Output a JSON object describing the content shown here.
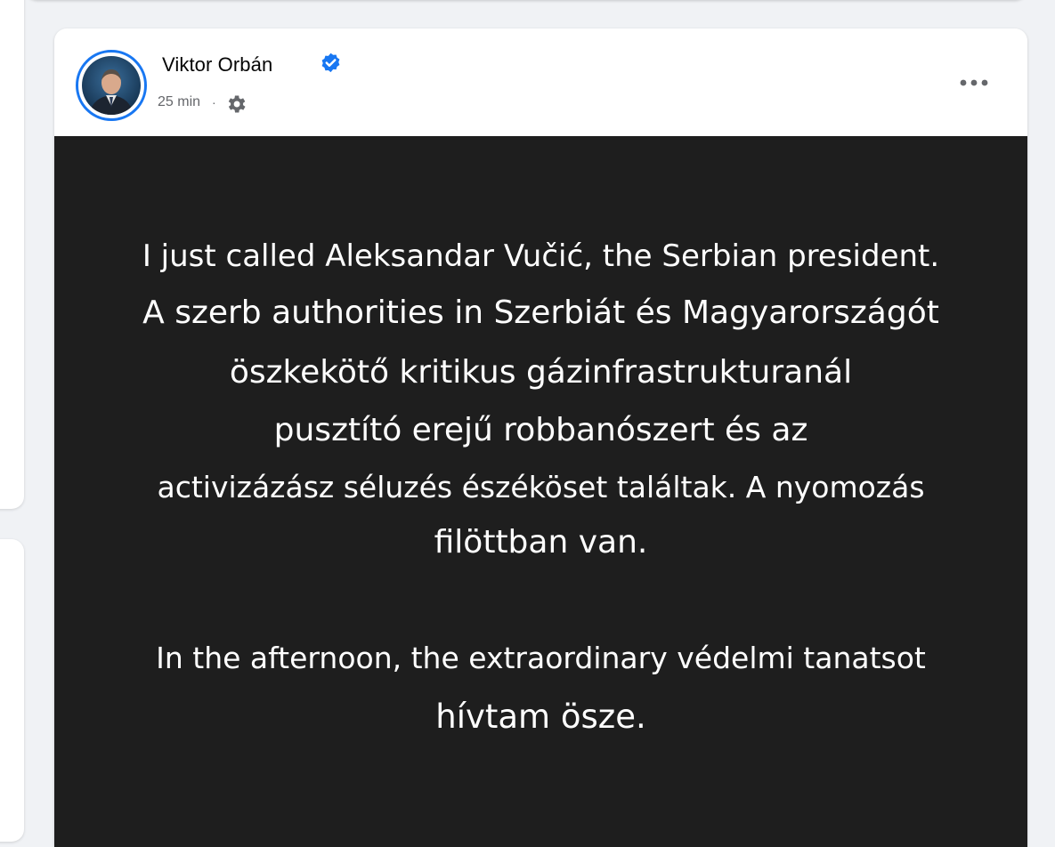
{
  "post": {
    "author": "Viktor Orbán",
    "time": "25 min",
    "meta_separator": "·",
    "icons": {
      "verified": "verified-badge-icon",
      "audience": "gear-icon",
      "more": "more-options-icon"
    },
    "accent_color": "#1877f2"
  },
  "image_text": {
    "line1": "I just called Aleksandar Vučić, the Serbian president.",
    "line2": "A szerb authorities in Szerbiát és Magyarországót",
    "line3": "öszkekötő kritikus gázinfrastrukturanál",
    "line4": "pusztító erejű robbanószert és az",
    "line5": "activizázász séluzés észéköset találtak. A nyomozás",
    "line6": "filöttban van.",
    "line7": "In the afternoon, the extraordinary védelmi tanatsot",
    "line8": "hívtam ösze."
  }
}
